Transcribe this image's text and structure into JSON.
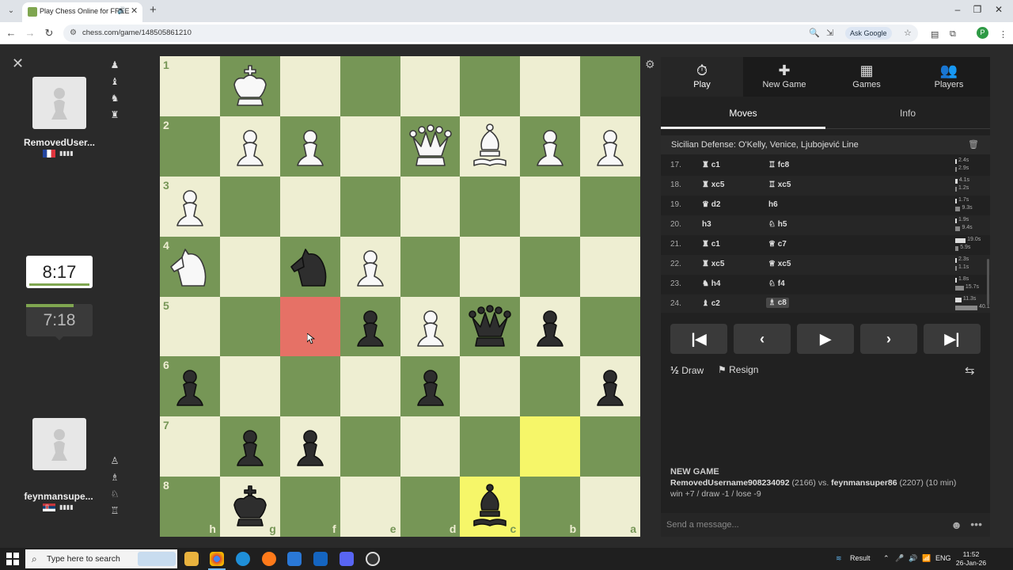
{
  "browser": {
    "tab_title": "Play Chess Online for FREE",
    "url": "chess.com/game/148505861210",
    "ask_google": "Ask Google",
    "profile_letter": "P"
  },
  "players": {
    "top": {
      "name": "RemovedUser...",
      "clock": "8:17",
      "captured": [
        "♟",
        "♝",
        "♞",
        "♜"
      ]
    },
    "bottom": {
      "name": "feynmansupe...",
      "clock": "7:18",
      "captured": [
        "♙",
        "♗",
        "♘",
        "♖"
      ]
    }
  },
  "board": {
    "ranks": [
      "1",
      "2",
      "3",
      "4",
      "5",
      "6",
      "7",
      "8"
    ],
    "files": [
      "h",
      "g",
      "f",
      "e",
      "d",
      "c",
      "b",
      "a"
    ],
    "highlight_red": "f5",
    "highlight_yellow": [
      "b7",
      "c8"
    ],
    "pieces": [
      {
        "sq": "g1",
        "type": "king",
        "color": "white"
      },
      {
        "sq": "g2",
        "type": "pawn",
        "color": "white"
      },
      {
        "sq": "f2",
        "type": "pawn",
        "color": "white"
      },
      {
        "sq": "d2",
        "type": "queen",
        "color": "white"
      },
      {
        "sq": "c2",
        "type": "bishop",
        "color": "white"
      },
      {
        "sq": "b2",
        "type": "pawn",
        "color": "white"
      },
      {
        "sq": "a2",
        "type": "pawn",
        "color": "white"
      },
      {
        "sq": "h3",
        "type": "pawn",
        "color": "white"
      },
      {
        "sq": "h4",
        "type": "knight",
        "color": "white"
      },
      {
        "sq": "f4",
        "type": "knight",
        "color": "black"
      },
      {
        "sq": "e4",
        "type": "pawn",
        "color": "white"
      },
      {
        "sq": "e5",
        "type": "pawn",
        "color": "black"
      },
      {
        "sq": "d5",
        "type": "pawn",
        "color": "white"
      },
      {
        "sq": "c5",
        "type": "queen",
        "color": "black"
      },
      {
        "sq": "b5",
        "type": "pawn",
        "color": "black"
      },
      {
        "sq": "h6",
        "type": "pawn",
        "color": "black"
      },
      {
        "sq": "d6",
        "type": "pawn",
        "color": "black"
      },
      {
        "sq": "a6",
        "type": "pawn",
        "color": "black"
      },
      {
        "sq": "g7",
        "type": "pawn",
        "color": "black"
      },
      {
        "sq": "f7",
        "type": "pawn",
        "color": "black"
      },
      {
        "sq": "g8",
        "type": "king",
        "color": "black"
      },
      {
        "sq": "c8",
        "type": "bishop",
        "color": "black"
      }
    ]
  },
  "panel": {
    "top_tabs": [
      {
        "label": "Play",
        "icon": "stopwatch-icon",
        "glyph": "⏱"
      },
      {
        "label": "New Game",
        "icon": "plus-icon",
        "glyph": "✚"
      },
      {
        "label": "Games",
        "icon": "board-icon",
        "glyph": "▦"
      },
      {
        "label": "Players",
        "icon": "players-icon",
        "glyph": "👥"
      }
    ],
    "sub_tabs": [
      "Moves",
      "Info"
    ],
    "opening": "Sicilian Defense: O'Kelly, Venice, Ljubojević Line",
    "moves": [
      {
        "num": "17.",
        "w_icon": "♜",
        "w": "c1",
        "b_icon": "♖",
        "b": "fc8",
        "wt": "2.4s",
        "bt": "2.9s",
        "wf": 0.06,
        "bf": 0.07
      },
      {
        "num": "18.",
        "w_icon": "♜",
        "w": "xc5",
        "b_icon": "♖",
        "b": "xc5",
        "wt": "4.1s",
        "bt": "1.2s",
        "wf": 0.1,
        "bf": 0.03
      },
      {
        "num": "19.",
        "w_icon": "♛",
        "w": "d2",
        "b_icon": "",
        "b": "h6",
        "wt": "1.7s",
        "bt": "9.3s",
        "wf": 0.04,
        "bf": 0.23
      },
      {
        "num": "20.",
        "w_icon": "",
        "w": "h3",
        "b_icon": "♘",
        "b": "h5",
        "wt": "1.9s",
        "bt": "9.4s",
        "wf": 0.05,
        "bf": 0.23
      },
      {
        "num": "21.",
        "w_icon": "♜",
        "w": "c1",
        "b_icon": "♕",
        "b": "c7",
        "wt": "19.0s",
        "bt": "5.9s",
        "wf": 0.47,
        "bf": 0.15
      },
      {
        "num": "22.",
        "w_icon": "♜",
        "w": "xc5",
        "b_icon": "♕",
        "b": "xc5",
        "wt": "2.3s",
        "bt": "1.1s",
        "wf": 0.06,
        "bf": 0.03
      },
      {
        "num": "23.",
        "w_icon": "♞",
        "w": "h4",
        "b_icon": "♘",
        "b": "f4",
        "wt": "1.8s",
        "bt": "15.7s",
        "wf": 0.05,
        "bf": 0.39
      },
      {
        "num": "24.",
        "w_icon": "♝",
        "w": "c2",
        "b_icon": "♗",
        "b": "c8",
        "wt": "11.3s",
        "bt": "40.1s",
        "wf": 0.28,
        "bf": 1.0
      }
    ],
    "controls": {
      "first": "|◀",
      "prev": "‹",
      "play": "▶",
      "next": "›",
      "last": "▶|"
    },
    "draw_label": "Draw",
    "draw_icon": "½",
    "resign_label": "Resign",
    "new_game": {
      "title": "NEW GAME",
      "white": "RemovedUsername908234092",
      "white_rating": "(2166)",
      "vs": "vs.",
      "black": "feynmansuper86",
      "black_rating": "(2207)",
      "time": "(10 min)",
      "result_line": "win +7 / draw -1 / lose -9"
    },
    "message_placeholder": "Send a message..."
  },
  "taskbar": {
    "search_placeholder": "Type here to search",
    "weather": "Result",
    "lang": "ENG",
    "time": "11:52",
    "date": "26-Jan-26"
  }
}
